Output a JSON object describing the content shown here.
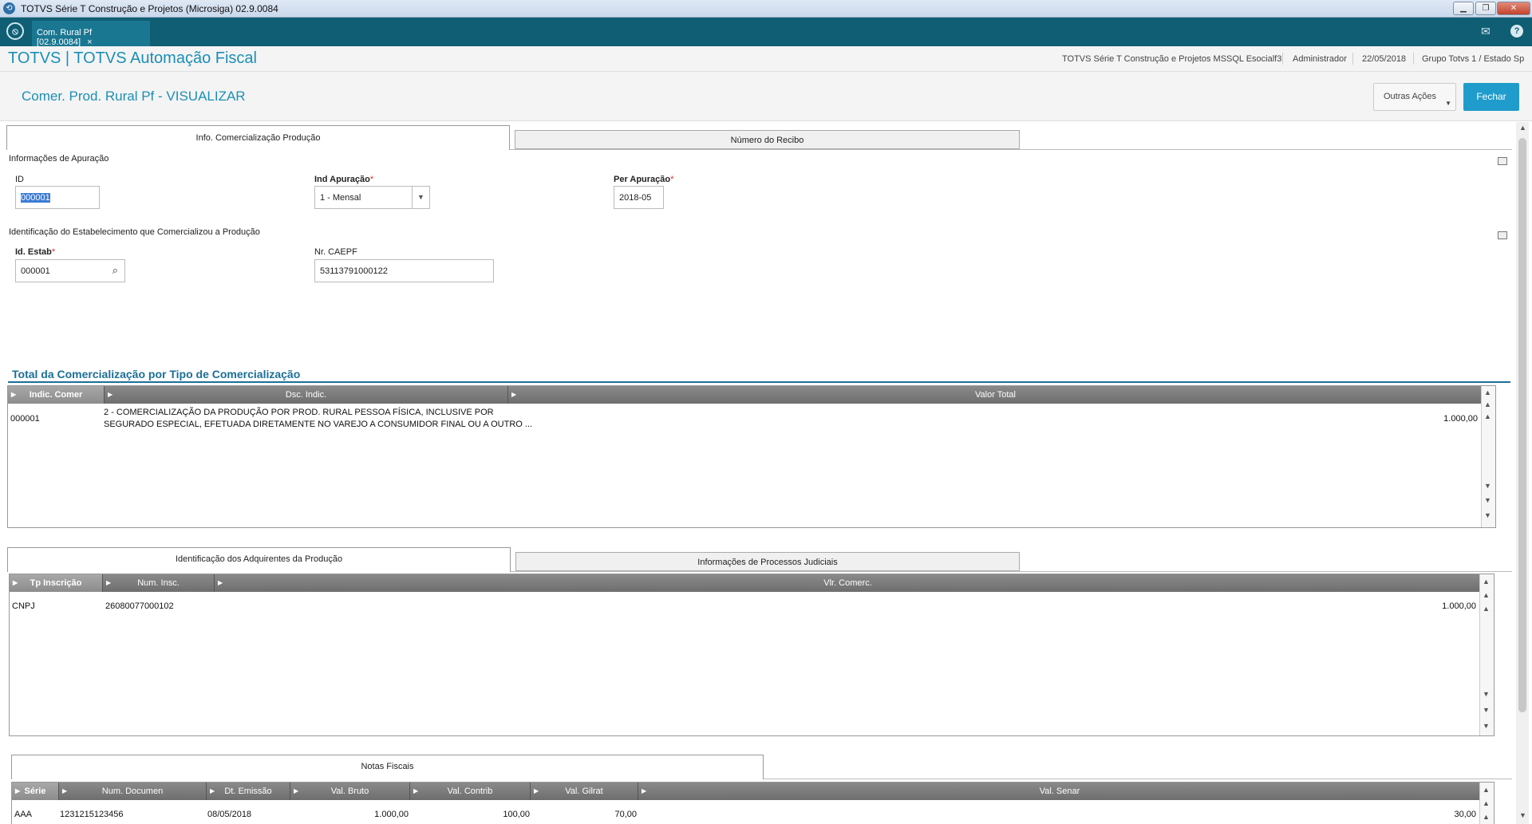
{
  "window": {
    "title": "TOTVS Série T Construção e Projetos (Microsiga) 02.9.0084",
    "buttons": {
      "minimize": "▁",
      "restore": "❐",
      "close": "✕"
    }
  },
  "appbar": {
    "tab_label": "Com. Rural Pf [02.9.0084]",
    "tab_close": "×",
    "icons": [
      "mail-icon",
      "help-icon"
    ]
  },
  "header": {
    "brand": "TOTVS | TOTVS Automação Fiscal",
    "environment": "TOTVS Série T Construção e Projetos MSSQL Esocialf3",
    "user": "Administrador",
    "date": "22/05/2018",
    "company": "Grupo Totvs 1 / Estado Sp"
  },
  "page": {
    "title": "Comer. Prod. Rural Pf - VISUALIZAR",
    "outras_acoes": "Outras Ações",
    "fechar": "Fechar"
  },
  "top_tabs": [
    "Info. Comercialização Produção",
    "Número do Recibo"
  ],
  "apuracao": {
    "section_label": "Informações de Apuração",
    "id_label": "ID",
    "id_value": "000001",
    "ind_label": "Ind Apuração",
    "ind_value": "1 - Mensal",
    "per_label": "Per Apuração",
    "per_value": "2018-05"
  },
  "estab": {
    "section_label": "Identificação do Estabelecimento que Comercializou a Produção",
    "id_label": "Id. Estab",
    "id_value": "000001",
    "caepf_label": "Nr. CAEPF",
    "caepf_value": "53113791000122"
  },
  "totals": {
    "title": "Total da Comercialização por Tipo de Comercialização",
    "columns": [
      "Indic. Comer",
      "Dsc. Indic.",
      "Valor Total"
    ],
    "rows": [
      {
        "indic": "000001",
        "dsc_line1": "2 - COMERCIALIZAÇÃO DA PRODUÇÃO POR PROD. RURAL PESSOA FÍSICA, INCLUSIVE POR",
        "dsc_line2": "SEGURADO ESPECIAL, EFETUADA DIRETAMENTE NO VAREJO A CONSUMIDOR FINAL OU A OUTRO ...",
        "valor": "1.000,00"
      }
    ]
  },
  "mid_tabs": [
    "Identificação dos Adquirentes da Produção",
    "Informações de Processos Judiciais"
  ],
  "adquirentes": {
    "columns": [
      "Tp Inscrição",
      "Num. Insc.",
      "Vlr. Comerc."
    ],
    "rows": [
      {
        "tp": "CNPJ",
        "num": "26080077000102",
        "vlr": "1.000,00"
      }
    ]
  },
  "notas_tab": "Notas Fiscais",
  "notas": {
    "columns": [
      "Série",
      "Num. Documen",
      "Dt. Emissão",
      "Val. Bruto",
      "Val. Contrib",
      "Val. Gilrat",
      "Val. Senar"
    ],
    "rows": [
      {
        "serie": "AAA",
        "num": "1231215123456",
        "dt": "08/05/2018",
        "bruto": "1.000,00",
        "contrib": "100,00",
        "gilrat": "70,00",
        "senar": "30,00"
      }
    ]
  }
}
